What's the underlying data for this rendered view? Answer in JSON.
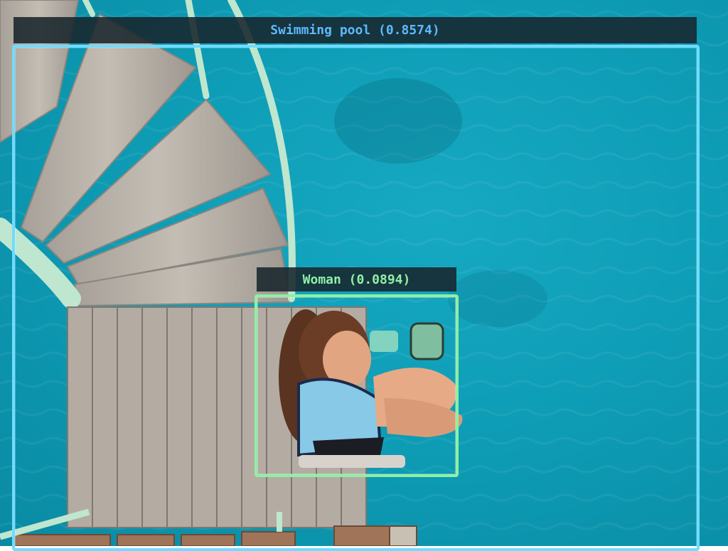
{
  "detections": [
    {
      "label": "Swimming pool",
      "score": "0.8574",
      "text": "Swimming pool (0.8574)",
      "color": "#5fd0ff"
    },
    {
      "label": "Woman",
      "score": "0.0894",
      "text": "Woman (0.0894)",
      "color": "#8ff0a4"
    }
  ],
  "colors": {
    "water": "#0e9db6",
    "deck_wood": "#b4aca3",
    "railing": "#bfe6cf",
    "label_background": "#18262c"
  }
}
